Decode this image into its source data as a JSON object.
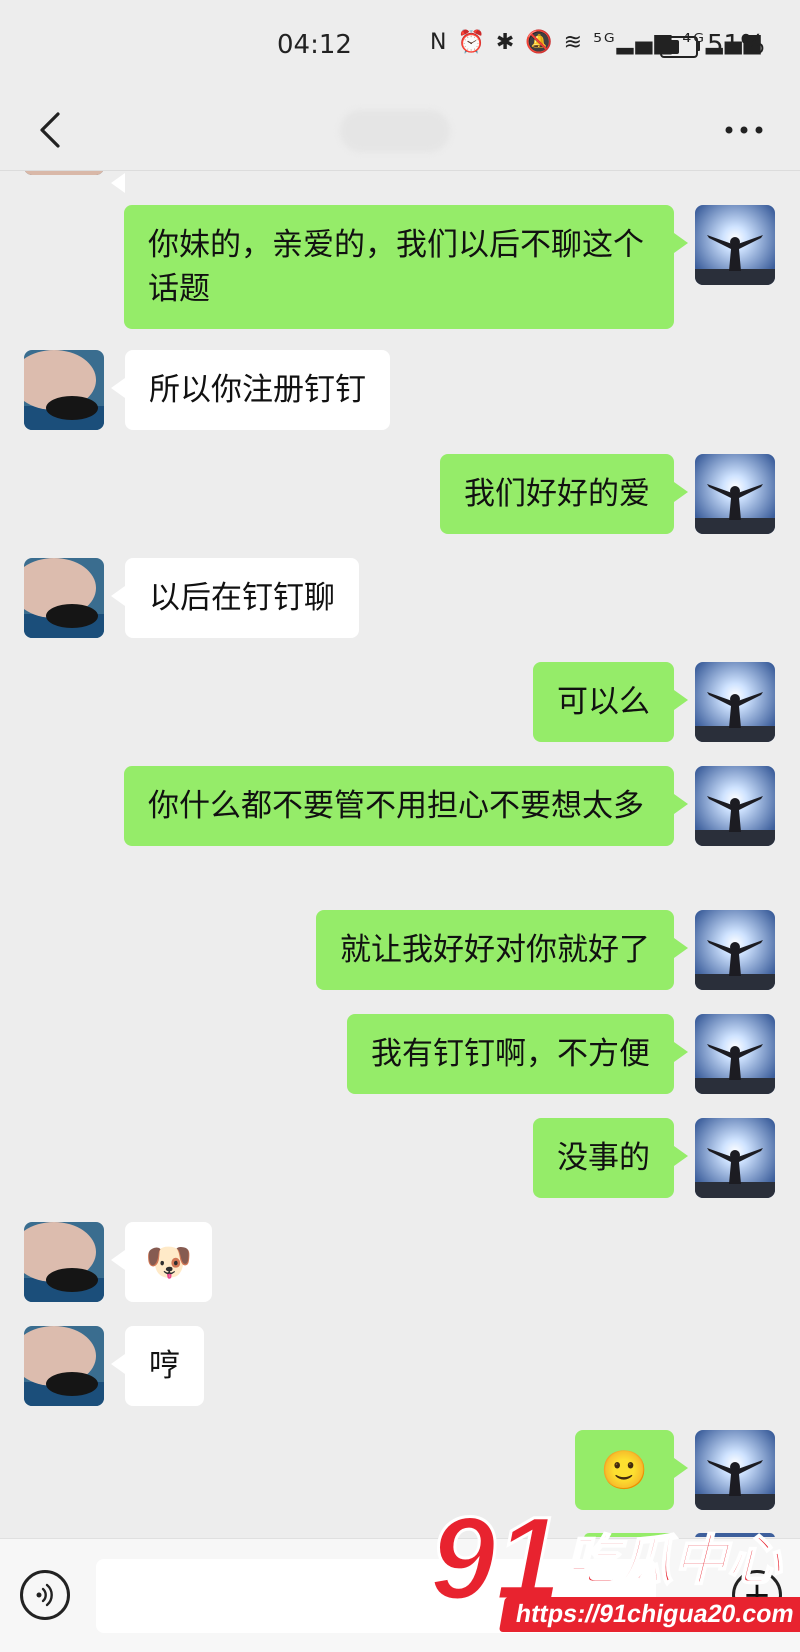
{
  "status_bar": {
    "time": "04:12",
    "icons": "N ⏰ ✱ 🔕 ≋ ⁵ᴳ▂▄▆ ⁴ᴳ▂▄▆",
    "battery_percent": "51%",
    "battery_level": 0.51
  },
  "nav": {
    "back_icon": "chevron-left-icon",
    "more_icon": "ellipsis-icon"
  },
  "colors": {
    "background": "#ededed",
    "my_bubble": "#95ec69",
    "other_bubble": "#ffffff",
    "watermark_red": "#e8232f"
  },
  "messages": [
    {
      "from": "me",
      "text": "你妹的，亲爱的，我们以后不聊这个话题"
    },
    {
      "from": "other",
      "text": "所以你注册钉钉"
    },
    {
      "from": "me",
      "text": "我们好好的爱"
    },
    {
      "from": "other",
      "text": "以后在钉钉聊"
    },
    {
      "from": "me",
      "text": "可以么"
    },
    {
      "from": "me",
      "text": "你什么都不要管不用担心不要想太多"
    },
    {
      "from": "me",
      "text": "就让我好好对你就好了"
    },
    {
      "from": "me",
      "text": "我有钉钉啊，不方便"
    },
    {
      "from": "me",
      "text": "没事的"
    },
    {
      "from": "other",
      "text": "🐶"
    },
    {
      "from": "other",
      "text": "哼"
    },
    {
      "from": "me",
      "text": "🙂"
    }
  ],
  "input_bar": {
    "voice_icon": "voice-icon",
    "input_value": "",
    "plus_icon": "plus-icon",
    "plus_label": "+"
  },
  "watermark": {
    "number": "91",
    "chinese": "吃瓜中心",
    "url": "https://91chigua20.com"
  }
}
